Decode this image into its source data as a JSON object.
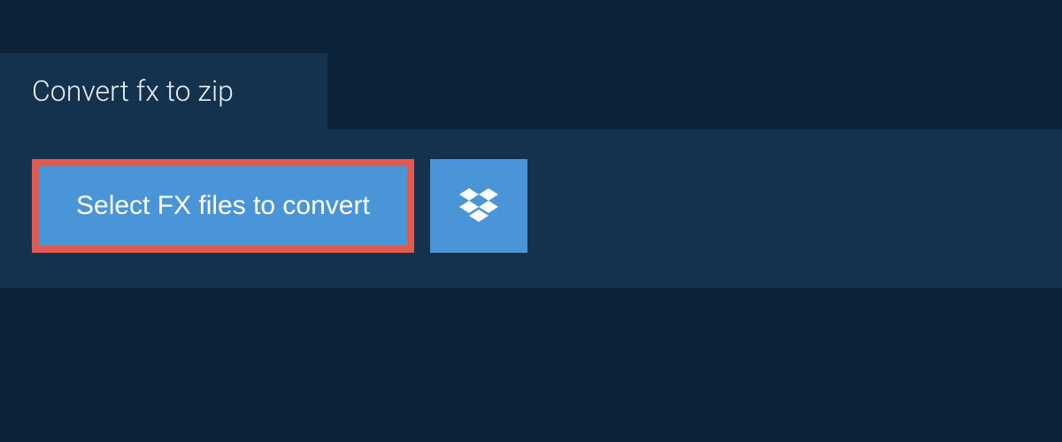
{
  "tab": {
    "label": "Convert fx to zip"
  },
  "actions": {
    "select_files_label": "Select FX files to convert"
  },
  "colors": {
    "background": "#0b2239",
    "panel": "#14324e",
    "button": "#4a94d8",
    "highlight_border": "#e05a4f",
    "text_light": "#ffffff"
  }
}
